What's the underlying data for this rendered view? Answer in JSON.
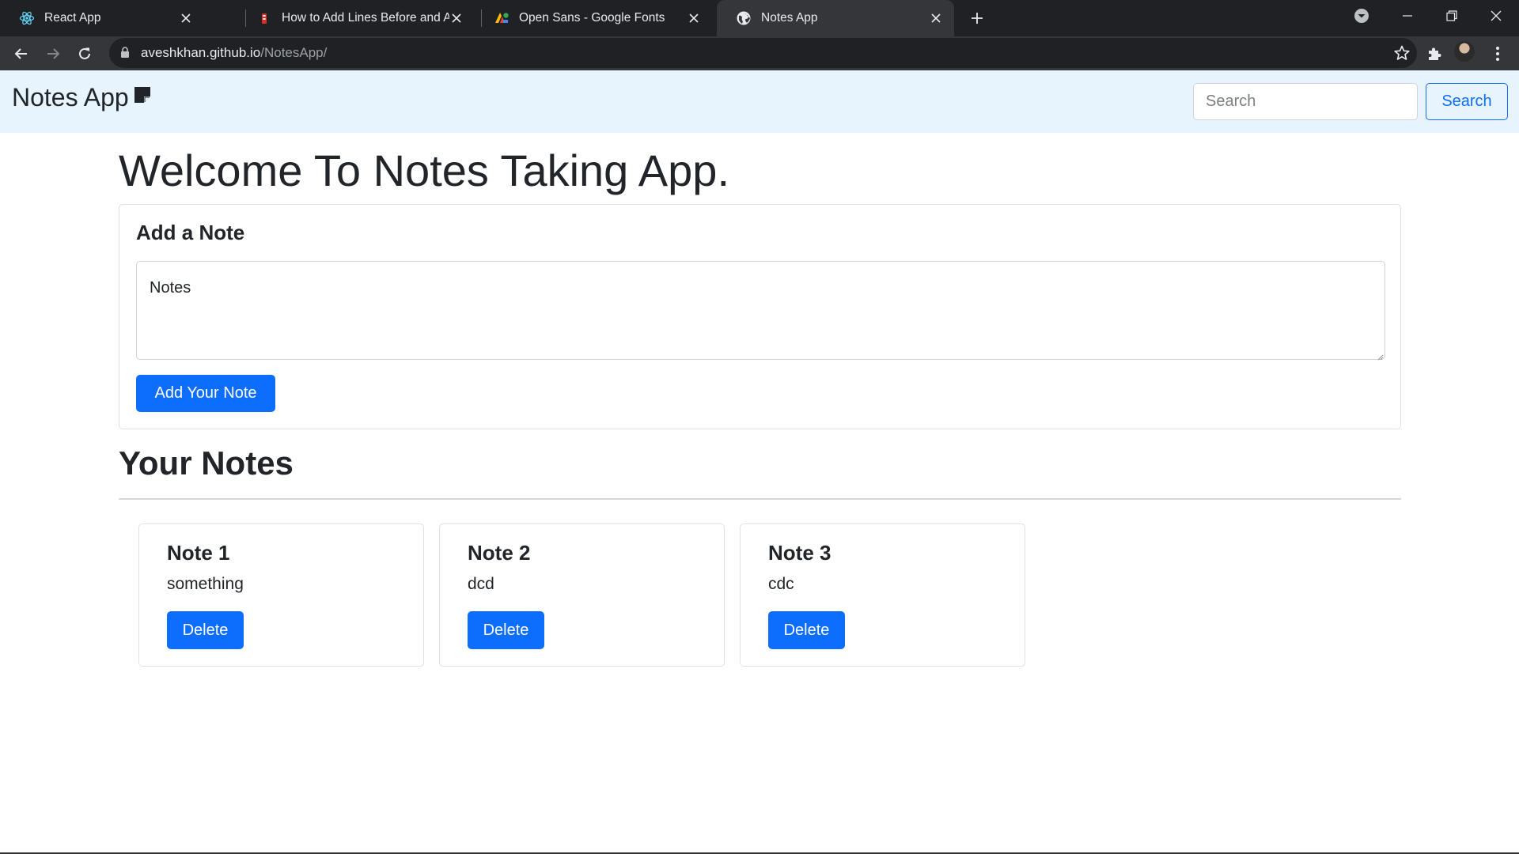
{
  "browser": {
    "tabs": [
      {
        "title": "React App",
        "icon": "react-icon",
        "active": false
      },
      {
        "title": "How to Add Lines Before and Aft",
        "icon": "article-icon",
        "active": false
      },
      {
        "title": "Open Sans - Google Fonts",
        "icon": "google-fonts-icon",
        "active": false
      },
      {
        "title": "Notes App",
        "icon": "globe-icon",
        "active": true
      }
    ],
    "url_host": "aveshkhan.github.io",
    "url_path": "/NotesApp/"
  },
  "navbar": {
    "brand": "Notes App",
    "search_placeholder": "Search",
    "search_button": "Search"
  },
  "main": {
    "heading": "Welcome To Notes Taking App.",
    "add_card": {
      "title": "Add a Note",
      "textarea_placeholder": "Notes",
      "button": "Add Your Note"
    },
    "notes_heading": "Your Notes",
    "notes": [
      {
        "title": "Note 1",
        "text": "something",
        "button": "Delete"
      },
      {
        "title": "Note 2",
        "text": "dcd",
        "button": "Delete"
      },
      {
        "title": "Note 3",
        "text": "cdc",
        "button": "Delete"
      }
    ]
  },
  "colors": {
    "primary": "#0d6efd",
    "navbar_bg": "#e7f3fd",
    "chrome_dark": "#202124",
    "chrome_toolbar": "#35363a"
  }
}
